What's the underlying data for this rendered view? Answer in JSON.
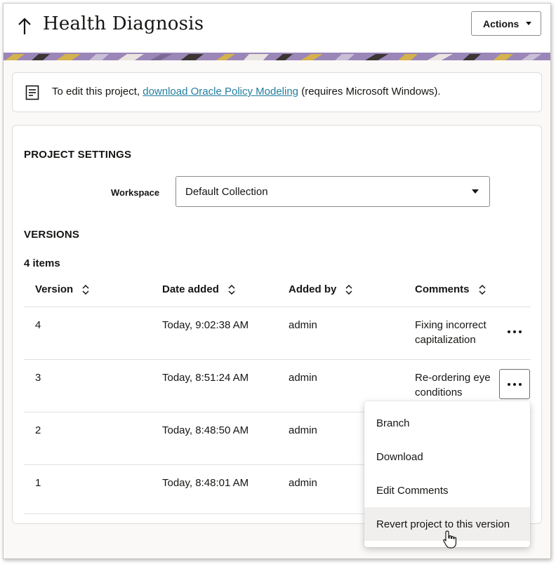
{
  "header": {
    "title": "Health Diagnosis",
    "actions_label": "Actions",
    "back_icon": "arrow-up-icon"
  },
  "info": {
    "icon": "document-icon",
    "text_before": "To edit this project, ",
    "link_text": "download Oracle Policy Modeling",
    "text_after": " (requires Microsoft Windows)."
  },
  "settings": {
    "heading": "PROJECT SETTINGS",
    "workspace_label": "Workspace",
    "workspace_value": "Default Collection"
  },
  "versions": {
    "heading": "VERSIONS",
    "count_label": "4 items",
    "columns": [
      "Version",
      "Date added",
      "Added by",
      "Comments"
    ],
    "rows": [
      {
        "version": "4",
        "date": "Today, 9:02:38 AM",
        "added_by": "admin",
        "comment_l1": "Fixing incorrect",
        "comment_l2": "capitalization"
      },
      {
        "version": "3",
        "date": "Today, 8:51:24 AM",
        "added_by": "admin",
        "comment_l1": "Re-ordering eye",
        "comment_l2": "conditions"
      },
      {
        "version": "2",
        "date": "Today, 8:48:50 AM",
        "added_by": "admin",
        "comment_l1": "",
        "comment_l2": ""
      },
      {
        "version": "1",
        "date": "Today, 8:48:01 AM",
        "added_by": "admin",
        "comment_l1": "",
        "comment_l2": ""
      }
    ]
  },
  "row_menu": {
    "items": [
      "Branch",
      "Download",
      "Edit Comments",
      "Revert project to this version"
    ]
  },
  "colors": {
    "link": "#227e9e",
    "banner_purple": "#9b86b8",
    "banner_gold": "#d4b24c",
    "text": "#161513"
  }
}
